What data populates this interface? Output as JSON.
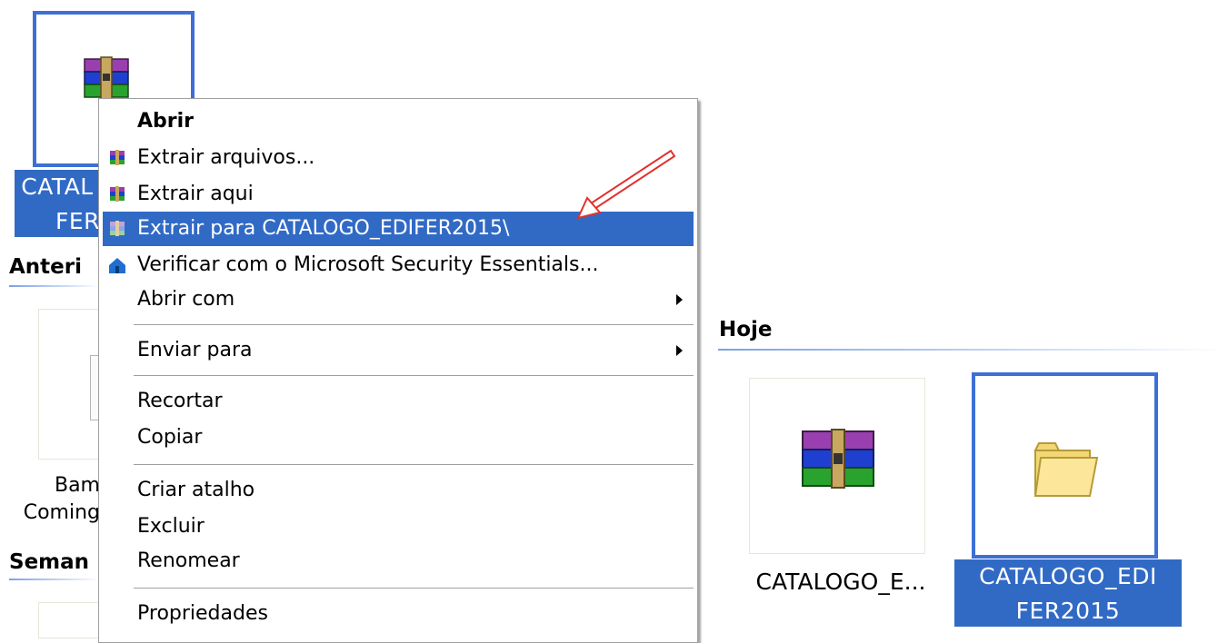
{
  "desktop": {
    "items": {
      "rar_top_label_1": "CATAL",
      "rar_top_label_2": "FER",
      "bam_label_1": "Bam",
      "bam_label_2": "Coming",
      "hoje_rar_label": "CATALOGO_E...",
      "hoje_folder_label_1": "CATALOGO_EDI",
      "hoje_folder_label_2": "FER2015"
    },
    "groups": {
      "anteri": "Anteri",
      "seman": "Seman",
      "hoje": "Hoje"
    }
  },
  "context_menu": {
    "items": [
      {
        "label": "Abrir",
        "icon": "none",
        "bold": true
      },
      {
        "label": "Extrair arquivos...",
        "icon": "winrar-icon"
      },
      {
        "label": "Extrair aqui",
        "icon": "winrar-icon"
      },
      {
        "label": "Extrair para CATALOGO_EDIFER2015\\",
        "icon": "winrar-icon",
        "highlighted": true
      },
      {
        "label": "Verificar com o Microsoft Security Essentials...",
        "icon": "security-essentials-icon"
      },
      {
        "label": "Abrir com",
        "submenu": true
      },
      {
        "label": "Enviar para",
        "submenu": true
      },
      {
        "label": "Recortar"
      },
      {
        "label": "Copiar"
      },
      {
        "label": "Criar atalho"
      },
      {
        "label": "Excluir"
      },
      {
        "label": "Renomear"
      },
      {
        "label": "Propriedades"
      }
    ]
  },
  "colors": {
    "selection": "#316ac5",
    "selection_border": "#3d6fd6",
    "annotation_arrow": "#e0322d"
  }
}
